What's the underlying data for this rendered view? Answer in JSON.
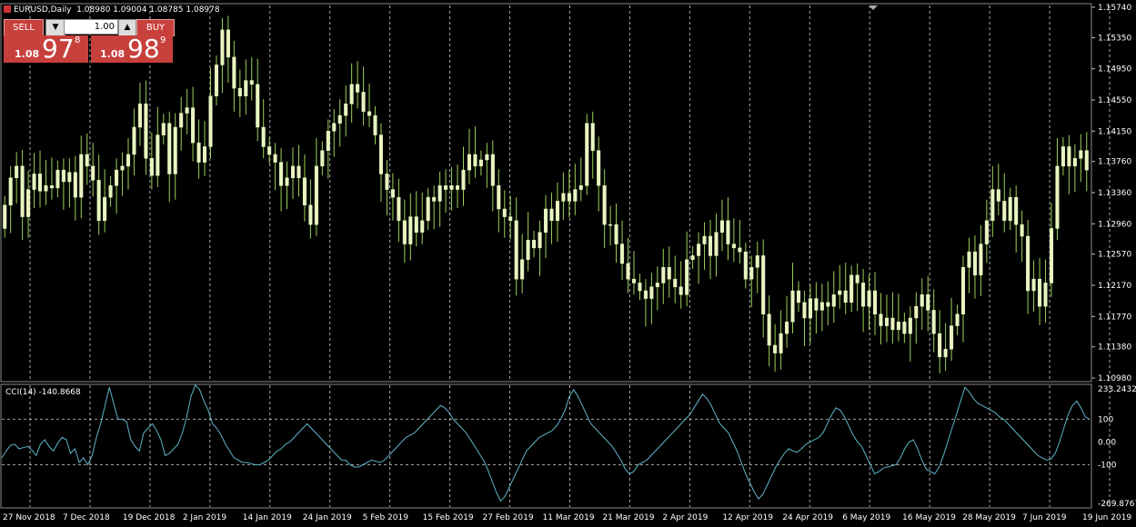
{
  "header": {
    "symbol": "EURUSD,Daily",
    "ohlc": "1.08980 1.09004 1.08785 1.08978"
  },
  "trade_panel": {
    "sell_label": "SELL",
    "buy_label": "BUY",
    "lot": "1.00",
    "sell_prefix": "1.08",
    "sell_big": "97",
    "sell_sup": "8",
    "buy_prefix": "1.08",
    "buy_big": "98",
    "buy_sup": "9"
  },
  "indicator": {
    "label": "CCI(14) -140.8668"
  },
  "colors": {
    "background": "#000000",
    "candle": "#e8f5c0",
    "wick": "#9ccf5a",
    "cci_line": "#5fb4c8",
    "grid": "#c8c8c8",
    "axis_text": "#ffffff"
  },
  "chart_data": [
    {
      "type": "candlestick",
      "price_axis_labels": [
        "1.15740",
        "1.15350",
        "1.14950",
        "1.14550",
        "1.14150",
        "1.13760",
        "1.13360",
        "1.12960",
        "1.12570",
        "1.12170",
        "1.11770",
        "1.11380",
        "1.10980"
      ],
      "ylim": [
        1.1098,
        1.1574
      ],
      "date_labels": [
        "27 Nov 2018",
        "7 Dec 2018",
        "19 Dec 2018",
        "2 Jan 2019",
        "14 Jan 2019",
        "24 Jan 2019",
        "5 Feb 2019",
        "15 Feb 2019",
        "27 Feb 2019",
        "11 Mar 2019",
        "21 Mar 2019",
        "2 Apr 2019",
        "12 Apr 2019",
        "24 Apr 2019",
        "6 May 2019",
        "16 May 2019",
        "28 May 2019",
        "7 Jun 2019",
        "19 Jun 2019"
      ],
      "close": [
        1.132,
        1.1355,
        1.137,
        1.1305,
        1.134,
        1.136,
        1.1338,
        1.1345,
        1.1342,
        1.1365,
        1.135,
        1.1362,
        1.133,
        1.1385,
        1.137,
        1.1352,
        1.13,
        1.133,
        1.1345,
        1.1365,
        1.137,
        1.1385,
        1.142,
        1.145,
        1.138,
        1.1358,
        1.141,
        1.1425,
        1.136,
        1.142,
        1.1438,
        1.1445,
        1.14,
        1.1375,
        1.1395,
        1.146,
        1.15,
        1.1545,
        1.151,
        1.147,
        1.146,
        1.148,
        1.1475,
        1.142,
        1.1395,
        1.1385,
        1.1375,
        1.1345,
        1.1355,
        1.137,
        1.1355,
        1.132,
        1.1295,
        1.137,
        1.139,
        1.1415,
        1.1425,
        1.1435,
        1.145,
        1.1475,
        1.1465,
        1.144,
        1.1435,
        1.141,
        1.136,
        1.134,
        1.133,
        1.13,
        1.127,
        1.1305,
        1.1285,
        1.13,
        1.133,
        1.1325,
        1.1345,
        1.134,
        1.1345,
        1.134,
        1.1365,
        1.1385,
        1.137,
        1.1378,
        1.1385,
        1.1345,
        1.1315,
        1.1305,
        1.13,
        1.1225,
        1.125,
        1.1275,
        1.1265,
        1.1285,
        1.1315,
        1.13,
        1.1325,
        1.1335,
        1.1325,
        1.134,
        1.1345,
        1.1425,
        1.139,
        1.1345,
        1.1295,
        1.1295,
        1.127,
        1.1245,
        1.1225,
        1.122,
        1.121,
        1.12,
        1.1215,
        1.122,
        1.124,
        1.1225,
        1.1215,
        1.1205,
        1.125,
        1.1255,
        1.127,
        1.128,
        1.1255,
        1.1285,
        1.13,
        1.127,
        1.1265,
        1.126,
        1.1225,
        1.124,
        1.1255,
        1.118,
        1.114,
        1.113,
        1.1155,
        1.117,
        1.121,
        1.1195,
        1.1175,
        1.12,
        1.1185,
        1.1195,
        1.119,
        1.1205,
        1.121,
        1.1195,
        1.123,
        1.122,
        1.119,
        1.121,
        1.118,
        1.1165,
        1.1175,
        1.116,
        1.117,
        1.1155,
        1.1175,
        1.119,
        1.1205,
        1.1185,
        1.1155,
        1.1125,
        1.1135,
        1.1165,
        1.118,
        1.124,
        1.126,
        1.123,
        1.127,
        1.13,
        1.134,
        1.1325,
        1.13,
        1.133,
        1.1295,
        1.128,
        1.121,
        1.1225,
        1.119,
        1.122,
        1.129,
        1.137,
        1.1395,
        1.137,
        1.138,
        1.139,
        1.1365
      ],
      "open_start": 1.129
    },
    {
      "type": "line",
      "name": "CCI(14)",
      "y_axis_labels": [
        "233.2432",
        "100",
        "0.00",
        "-100",
        "-269.8767"
      ],
      "ylim": [
        -269.8767,
        233.2432
      ],
      "values": [
        -70,
        -40,
        -15,
        -10,
        -30,
        -25,
        -20,
        -35,
        -60,
        -10,
        10,
        -20,
        -40,
        -5,
        20,
        10,
        -50,
        -30,
        -90,
        -70,
        -100,
        -60,
        20,
        80,
        160,
        240,
        170,
        100,
        100,
        90,
        10,
        -20,
        -40,
        40,
        60,
        80,
        50,
        10,
        -60,
        -50,
        -30,
        -10,
        40,
        110,
        200,
        250,
        230,
        180,
        140,
        80,
        60,
        30,
        -10,
        -40,
        -70,
        -80,
        -90,
        -90,
        -95,
        -100,
        -100,
        -90,
        -80,
        -60,
        -40,
        -30,
        -10,
        0,
        20,
        40,
        60,
        80,
        60,
        40,
        20,
        0,
        -20,
        -40,
        -60,
        -80,
        -80,
        -100,
        -110,
        -110,
        -100,
        -90,
        -80,
        -85,
        -90,
        -80,
        -60,
        -40,
        -20,
        0,
        20,
        30,
        40,
        60,
        80,
        100,
        120,
        140,
        160,
        150,
        130,
        100,
        80,
        60,
        40,
        10,
        -20,
        -50,
        -80,
        -120,
        -170,
        -220,
        -260,
        -240,
        -200,
        -160,
        -120,
        -80,
        -40,
        -20,
        0,
        20,
        30,
        40,
        50,
        70,
        100,
        140,
        200,
        230,
        200,
        160,
        120,
        80,
        60,
        40,
        20,
        0,
        -20,
        -50,
        -80,
        -120,
        -140,
        -130,
        -100,
        -90,
        -80,
        -60,
        -40,
        -20,
        0,
        20,
        40,
        60,
        80,
        100,
        120,
        150,
        180,
        210,
        190,
        160,
        120,
        80,
        60,
        40,
        0,
        -40,
        -90,
        -140,
        -180,
        -220,
        -250,
        -230,
        -190,
        -150,
        -110,
        -80,
        -50,
        -30,
        -40,
        -45,
        -30,
        -10,
        0,
        10,
        20,
        40,
        80,
        120,
        150,
        140,
        110,
        70,
        30,
        0,
        -20,
        -60,
        -100,
        -140,
        -130,
        -115,
        -110,
        -105,
        -100,
        -70,
        -30,
        0,
        10,
        -30,
        -80,
        -120,
        -130,
        -140,
        -110,
        -60,
        0,
        60,
        120,
        180,
        240,
        220,
        190,
        170,
        160,
        150,
        140,
        130,
        110,
        100,
        80,
        60,
        40,
        20,
        0,
        -20,
        -40,
        -60,
        -70,
        -80,
        -75,
        -50,
        0,
        60,
        120,
        160,
        180,
        150,
        110,
        100
      ]
    }
  ]
}
